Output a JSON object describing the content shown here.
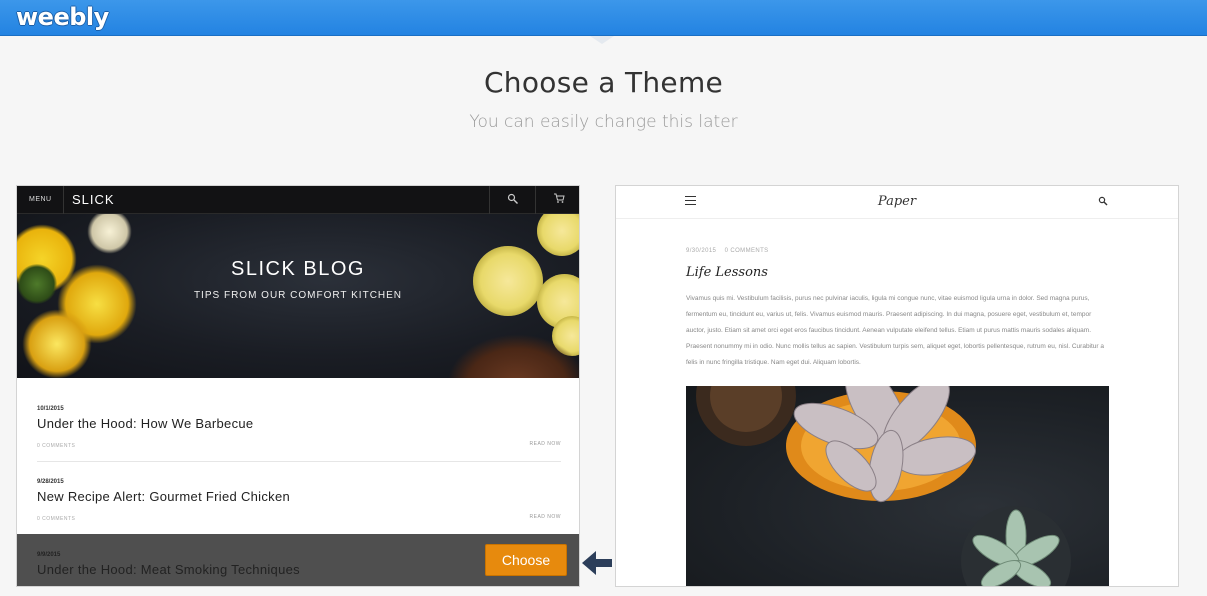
{
  "header": {
    "logo_text": "weebly",
    "brand_color": "#2383e2"
  },
  "page": {
    "title": "Choose a Theme",
    "subtitle": "You can easily change this later"
  },
  "themes": [
    {
      "name": "Slick",
      "nav": {
        "menu_label": "MENU",
        "brand": "SLICK",
        "search_icon": "search-icon",
        "cart_icon": "cart-icon"
      },
      "hero": {
        "title": "SLICK BLOG",
        "subtitle": "TIPS FROM OUR COMFORT KITCHEN"
      },
      "posts": [
        {
          "date": "10/1/2015",
          "title": "Under the Hood: How We Barbecue",
          "comments": "0 COMMENTS",
          "read_more": "READ NOW"
        },
        {
          "date": "9/28/2015",
          "title": "New Recipe Alert: Gourmet Fried Chicken",
          "comments": "0 COMMENTS",
          "read_more": "READ NOW"
        },
        {
          "date": "9/9/2015",
          "title": "Under the Hood: Meat Smoking Techniques"
        }
      ],
      "choose_label": "Choose",
      "accent_color": "#e78a0d"
    },
    {
      "name": "Paper",
      "nav": {
        "brand": "Paper",
        "menu_icon": "hamburger-icon",
        "search_icon": "search-icon"
      },
      "post": {
        "date": "9/30/2015",
        "comments": "0 COMMENTS",
        "title": "Life Lessons",
        "body": "Vivamus quis mi. Vestibulum facilisis, purus nec pulvinar iaculis, ligula mi congue nunc, vitae euismod ligula urna in dolor. Sed magna purus, fermentum eu, tincidunt eu, varius ut, felis. Vivamus euismod mauris. Praesent adipiscing. In dui magna, posuere eget, vestibulum et, tempor auctor, justo. Etiam sit amet orci eget eros faucibus tincidunt. Aenean vulputate eleifend tellus. Etiam ut purus mattis mauris sodales aliquam. Praesent nonummy mi in odio. Nunc mollis tellus ac sapien. Vestibulum turpis sem, aliquet eget, lobortis pellentesque, rutrum eu, nisl. Curabitur a felis in nunc fringilla tristique. Nam eget dui. Aliquam lobortis."
      }
    }
  ]
}
